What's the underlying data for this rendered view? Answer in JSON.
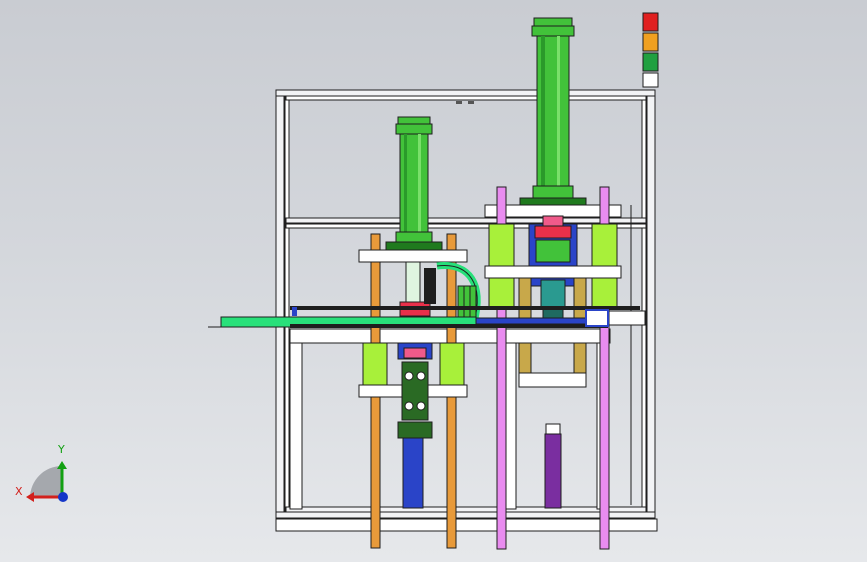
{
  "viewport": {
    "background_top": "#c9ccd2",
    "background_bottom": "#e6e8eb"
  },
  "axis_triad": {
    "x_label": "X",
    "y_label": "Y",
    "x_color": "#d2201c",
    "y_color": "#12a012",
    "z_color": "#1436c8"
  },
  "model": {
    "colors": {
      "frame": "#f2f3f5",
      "frame_edge": "#1e1e1e",
      "cylinder_green": "#42c23a",
      "cylinder_green_dark": "#1f7a1e",
      "lime": "#a8f03a",
      "orange_rod": "#e89a3a",
      "pink_rod": "#e98cf0",
      "blue_rod": "#2a44c8",
      "purple_rod": "#7a2ea0",
      "red_block": "#e8304a",
      "pink_block": "#f05a8a",
      "teal": "#2a9a90",
      "brass": "#c8a84a",
      "conveyor": "#28e07a",
      "dark_green_motor": "#2a6a24"
    },
    "stack_light": [
      "red",
      "orange",
      "green",
      "white"
    ]
  }
}
